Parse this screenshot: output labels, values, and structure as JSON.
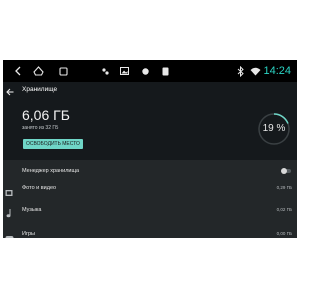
{
  "status_bar": {
    "time": "14:24",
    "nav_icons": [
      "chevron-left-icon",
      "home-icon",
      "recents-icon",
      "app-icon",
      "gallery-icon",
      "app-icon",
      "sim-icon"
    ],
    "status_icons": [
      "bluetooth-icon",
      "wifi-icon"
    ],
    "time_color": "#2bd4c4"
  },
  "header": {
    "title": "Хранилище"
  },
  "summary": {
    "used": "6,06 ГБ",
    "of_total": "занято из 32 ГБ",
    "used_percent": 19,
    "used_percent_label": "19 %",
    "free_space_button": "ОСВОБОДИТЬ МЕСТО",
    "accent_color": "#6fd6c7"
  },
  "list": {
    "storage_manager": {
      "label": "Менеджер хранилища",
      "enabled": false
    },
    "items": [
      {
        "label": "Фото и видео",
        "size": "0,29 ГБ",
        "icon": "photos-icon"
      },
      {
        "label": "Музыка",
        "size": "0,02 ГБ",
        "icon": "music-icon"
      },
      {
        "label": "Игры",
        "size": "0,00 ГБ",
        "icon": "games-icon"
      }
    ]
  }
}
